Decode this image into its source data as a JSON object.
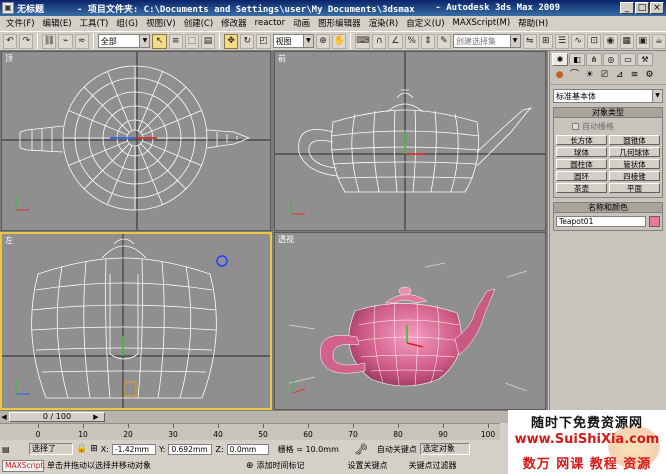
{
  "window": {
    "doc_title": "无标题",
    "project_path": "- 项目文件夹: C:\\Documents and Settings\\user\\My Documents\\3dsmax",
    "app_name": "- Autodesk 3ds Max  2009"
  },
  "menu": [
    "文件(F)",
    "编辑(E)",
    "工具(T)",
    "组(G)",
    "视图(V)",
    "创建(C)",
    "修改器",
    "reactor",
    "动画",
    "图形编辑器",
    "渲染(R)",
    "自定义(U)",
    "MAXScript(M)",
    "帮助(H)"
  ],
  "toolbar": {
    "selection_filter": "全部",
    "coord_system": "视图",
    "named_selection": "创建选择集"
  },
  "viewports": [
    {
      "id": "top",
      "label": "顶"
    },
    {
      "id": "front",
      "label": "前"
    },
    {
      "id": "left",
      "label": "左"
    },
    {
      "id": "perspective",
      "label": "透视"
    }
  ],
  "command_panel": {
    "category": "标准基本体",
    "rollout_object_type": "对象类型",
    "autogrid": "自动栅格",
    "object_buttons": [
      "长方体",
      "圆锥体",
      "球体",
      "几何球体",
      "圆柱体",
      "管状体",
      "圆环",
      "四棱锥",
      "茶壶",
      "平面"
    ],
    "rollout_name_color": "名称和颜色",
    "object_name": "Teapot01",
    "object_color": "#e87a9a"
  },
  "timeline": {
    "frame": "0 / 100",
    "ticks": [
      0,
      10,
      20,
      30,
      40,
      50,
      60,
      70,
      80,
      90,
      100
    ]
  },
  "status": {
    "maxscript": "MAXScript.",
    "selection": "选择了",
    "x_label": "X:",
    "x_value": "-1.42mm",
    "y_label": "Y:",
    "y_value": "0.692mm",
    "z_label": "Z:",
    "z_value": "0.0mm",
    "grid": "栅格 = 10.0mm",
    "prompt": "单击并拖动以选择并移动对象",
    "add_time_tag": "添加时间标记",
    "auto_key": "自动关键点",
    "set_key": "设置关键点",
    "selected_objects": "选定对象",
    "key_filters": "关键点过滤器"
  },
  "watermark": {
    "line1": "随时下免费资源网",
    "line2": "www.SuiShiXia.com",
    "line3": "数万 网课 教程 资源"
  }
}
